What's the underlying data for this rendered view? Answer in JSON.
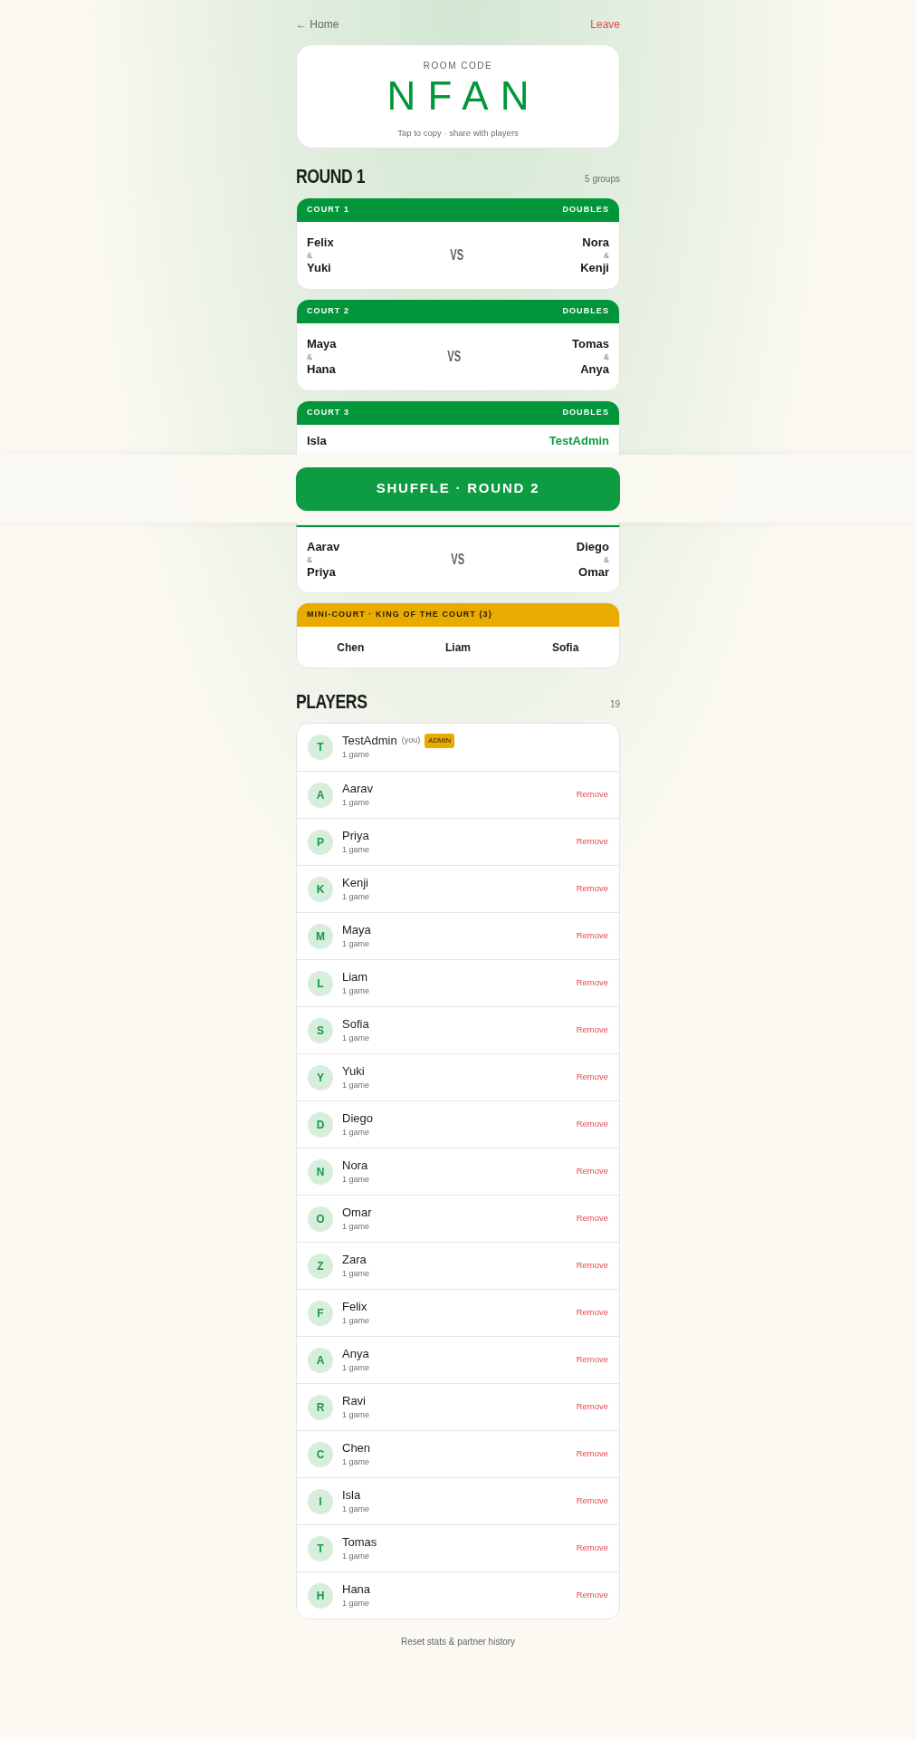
{
  "nav": {
    "back": "← Home",
    "leave": "Leave"
  },
  "room": {
    "label": "ROOM CODE",
    "code": "NFAN",
    "hint": "Tap to copy · share with players"
  },
  "round": {
    "title": "ROUND 1",
    "count": "5 groups"
  },
  "courts": [
    {
      "kind": "match",
      "header": {
        "label": "COURT 1",
        "type": "DOUBLES"
      },
      "vs": "VS",
      "team_a": {
        "names": [
          {
            "name": "Felix",
            "is_you": false
          },
          {
            "name": "Yuki",
            "is_you": false
          }
        ],
        "joiner": "&"
      },
      "team_b": {
        "names": [
          {
            "name": "Nora",
            "is_you": false
          },
          {
            "name": "Kenji",
            "is_you": false
          }
        ],
        "joiner": "&"
      }
    },
    {
      "kind": "match",
      "header": {
        "label": "COURT 2",
        "type": "DOUBLES"
      },
      "vs": "VS",
      "team_a": {
        "names": [
          {
            "name": "Maya",
            "is_you": false
          },
          {
            "name": "Hana",
            "is_you": false
          }
        ],
        "joiner": "&"
      },
      "team_b": {
        "names": [
          {
            "name": "Tomas",
            "is_you": false
          },
          {
            "name": "Anya",
            "is_you": false
          }
        ],
        "joiner": "&"
      }
    },
    {
      "kind": "match",
      "header": {
        "label": "COURT 3",
        "type": "DOUBLES"
      },
      "team_a": {
        "names": [
          {
            "name": "Isla",
            "is_you": false
          }
        ]
      },
      "team_b": {
        "names": [
          {
            "name": "TestAdmin",
            "is_you": true
          }
        ]
      }
    },
    {
      "kind": "match",
      "vs": "VS",
      "team_a": {
        "names": [
          {
            "name": "Aarav",
            "is_you": false
          },
          {
            "name": "Priya",
            "is_you": false
          }
        ],
        "joiner": "&"
      },
      "team_b": {
        "names": [
          {
            "name": "Diego",
            "is_you": false
          },
          {
            "name": "Omar",
            "is_you": false
          }
        ],
        "joiner": "&"
      }
    },
    {
      "kind": "mini",
      "header": {
        "label": "MINI-COURT · KING OF THE COURT (3)"
      },
      "players": [
        "Chen",
        "Liam",
        "Sofia"
      ]
    }
  ],
  "shuffle_button": "SHUFFLE · ROUND 2",
  "players": {
    "title": "PLAYERS",
    "count": "19",
    "list": [
      {
        "initial": "T",
        "name": "TestAdmin",
        "you_tag": "(you)",
        "badge": "ADMIN",
        "games": "1 game"
      },
      {
        "initial": "A",
        "name": "Aarav",
        "games": "1 game",
        "action": "Remove"
      },
      {
        "initial": "P",
        "name": "Priya",
        "games": "1 game",
        "action": "Remove"
      },
      {
        "initial": "K",
        "name": "Kenji",
        "games": "1 game",
        "action": "Remove"
      },
      {
        "initial": "M",
        "name": "Maya",
        "games": "1 game",
        "action": "Remove"
      },
      {
        "initial": "L",
        "name": "Liam",
        "games": "1 game",
        "action": "Remove"
      },
      {
        "initial": "S",
        "name": "Sofia",
        "games": "1 game",
        "action": "Remove"
      },
      {
        "initial": "Y",
        "name": "Yuki",
        "games": "1 game",
        "action": "Remove"
      },
      {
        "initial": "D",
        "name": "Diego",
        "games": "1 game",
        "action": "Remove"
      },
      {
        "initial": "N",
        "name": "Nora",
        "games": "1 game",
        "action": "Remove"
      },
      {
        "initial": "O",
        "name": "Omar",
        "games": "1 game",
        "action": "Remove"
      },
      {
        "initial": "Z",
        "name": "Zara",
        "games": "1 game",
        "action": "Remove"
      },
      {
        "initial": "F",
        "name": "Felix",
        "games": "1 game",
        "action": "Remove"
      },
      {
        "initial": "A",
        "name": "Anya",
        "games": "1 game",
        "action": "Remove"
      },
      {
        "initial": "R",
        "name": "Ravi",
        "games": "1 game",
        "action": "Remove"
      },
      {
        "initial": "C",
        "name": "Chen",
        "games": "1 game",
        "action": "Remove"
      },
      {
        "initial": "I",
        "name": "Isla",
        "games": "1 game",
        "action": "Remove"
      },
      {
        "initial": "T",
        "name": "Tomas",
        "games": "1 game",
        "action": "Remove"
      },
      {
        "initial": "H",
        "name": "Hana",
        "games": "1 game",
        "action": "Remove"
      }
    ]
  },
  "reset": "Reset stats & partner history"
}
